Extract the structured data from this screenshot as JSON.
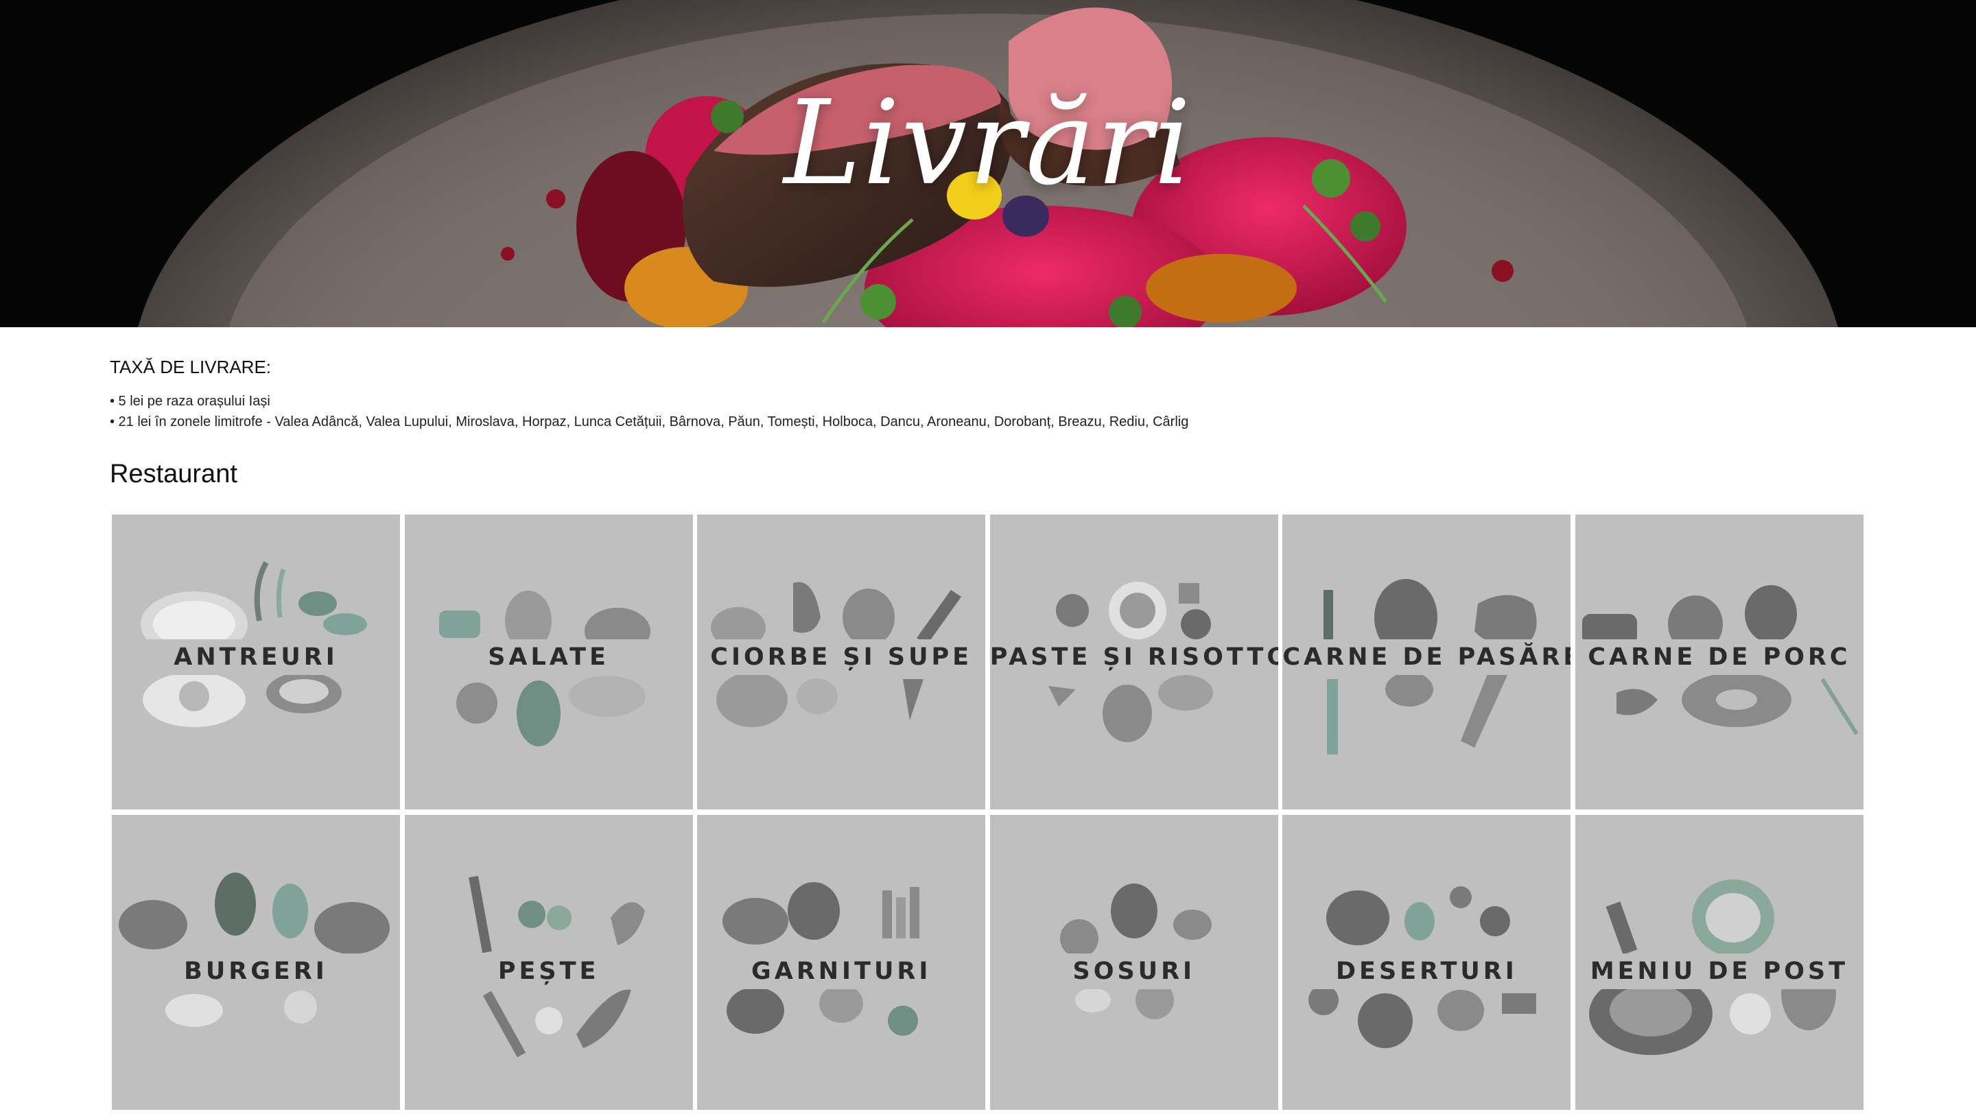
{
  "hero": {
    "title": "Livrări"
  },
  "delivery": {
    "heading": "TAXĂ DE LIVRARE:",
    "items": [
      "• 5 lei pe raza orașului Iași",
      "• 21 lei în zonele limitrofe - Valea Adâncă, Valea Lupului, Miroslava, Horpaz, Lunca Cetățuii, Bârnova, Păun, Tomești, Holboca, Dancu, Aroneanu, Dorobanț, Breazu, Rediu, Cârlig"
    ]
  },
  "restaurant": {
    "title": "Restaurant",
    "categories": [
      {
        "label": "ANTREURI",
        "icon": "avocado-herbs-icon"
      },
      {
        "label": "SALATE",
        "icon": "salad-vegetables-icon"
      },
      {
        "label": "CIORBE ȘI SUPE",
        "icon": "soup-vegetables-icon"
      },
      {
        "label": "PASTE ȘI RISOTTO",
        "icon": "pasta-mushroom-icon"
      },
      {
        "label": "CARNE DE PASĂRE",
        "icon": "poultry-icon"
      },
      {
        "label": "CARNE DE PORC",
        "icon": "pork-icon"
      },
      {
        "label": "BURGERI",
        "icon": "burger-icon"
      },
      {
        "label": "PEȘTE",
        "icon": "fish-icon"
      },
      {
        "label": "GARNITURI",
        "icon": "side-dishes-icon"
      },
      {
        "label": "SOSURI",
        "icon": "sauce-icon"
      },
      {
        "label": "DESERTURI",
        "icon": "dessert-icon"
      },
      {
        "label": "MENIU DE POST",
        "icon": "fasting-menu-icon"
      }
    ]
  },
  "colors": {
    "tile_background": "#bfbfbf",
    "tile_text": "#2b2b2b",
    "accent_mint": "#8fb8aa",
    "beet_red": "#c2144b"
  }
}
